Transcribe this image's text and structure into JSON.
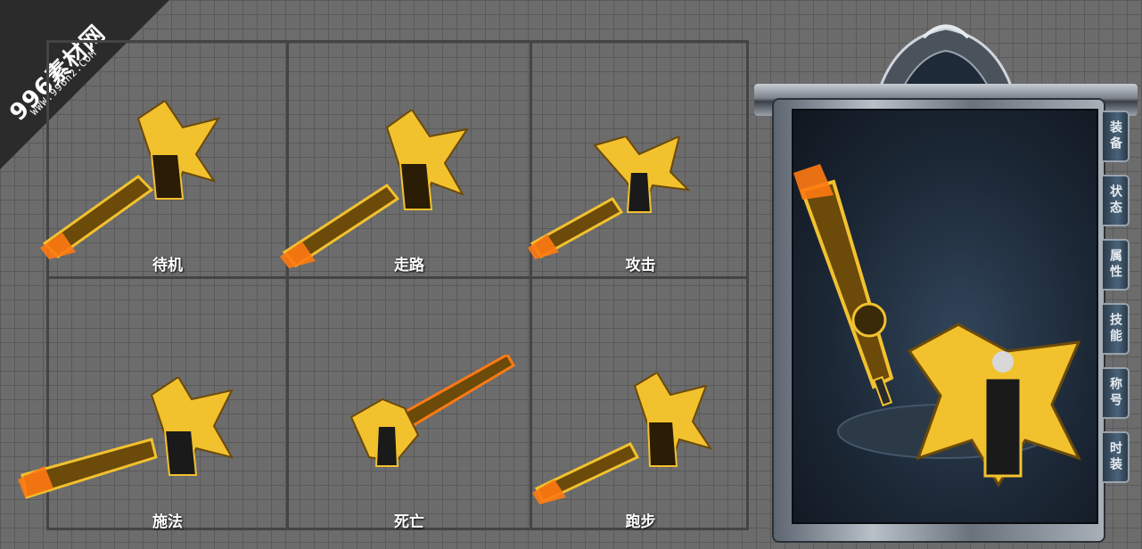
{
  "watermark": {
    "brand": "996素材网",
    "url": "WWW.996n2.COM"
  },
  "animation_cells": [
    {
      "label": "待机"
    },
    {
      "label": "走路"
    },
    {
      "label": "攻击"
    },
    {
      "label": "施法"
    },
    {
      "label": "死亡"
    },
    {
      "label": "跑步"
    }
  ],
  "equipment_panel": {
    "tabs": [
      {
        "label": "装备"
      },
      {
        "label": "状态"
      },
      {
        "label": "属性"
      },
      {
        "label": "技能"
      },
      {
        "label": "称号"
      },
      {
        "label": "时装"
      }
    ]
  },
  "colors": {
    "gold": "#f2c12e",
    "flame": "#ff7a12",
    "dark_gold": "#6b4a0a",
    "panel_bg": "#1c2836"
  }
}
